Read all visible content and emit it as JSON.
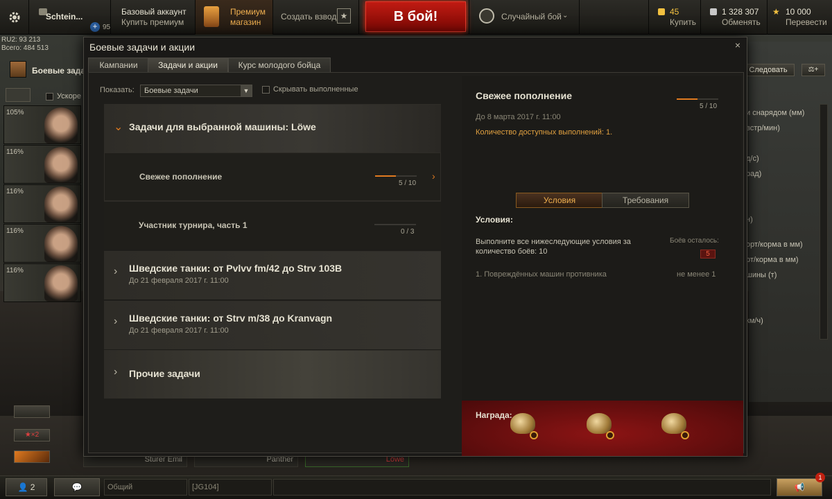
{
  "header": {
    "username": "Schtein...",
    "xp_boost_count": "95",
    "account_type": "Базовый аккаунт",
    "buy_premium": "Купить премиум",
    "premium_shop_line1": "Премиум",
    "premium_shop_line2": "магазин",
    "create_platoon": "Создать взвод",
    "battle_button": "В бой!",
    "battle_mode": "Случайный бой",
    "gold": "45",
    "gold_action": "Купить",
    "silver": "1 328 307",
    "silver_action": "Обменять",
    "free_xp": "10 000",
    "free_xp_action": "Перевести"
  },
  "server_info": {
    "line1": "RU2: 93 213",
    "line2": "Всего: 484 513"
  },
  "left_side": {
    "missions_label": "Боевые задач",
    "accelerate_label": "Ускоре"
  },
  "crew": [
    {
      "pct": "105%"
    },
    {
      "pct": "116%"
    },
    {
      "pct": "116%"
    },
    {
      "pct": "116%"
    },
    {
      "pct": "116%"
    }
  ],
  "right_side": {
    "research_button": "Следовать",
    "stats": [
      "и снарядом (мм)",
      "встр/мин)",
      "д/с)",
      "рад)",
      "н)",
      "орт/корма в мм)",
      "рт/корма в мм)",
      "шины (т)",
      "км/ч)"
    ]
  },
  "modal": {
    "title": "Боевые задачи и акции",
    "close": "×",
    "tabs": [
      "Кампании",
      "Задачи и акции",
      "Курс молодого бойца"
    ],
    "filter_label": "Показать:",
    "filter_value": "Боевые задачи",
    "hide_completed": "Скрывать выполненные",
    "groups": {
      "vehicle_group_title": "Задачи для выбранной машины: Löwe",
      "tasks": [
        {
          "name": "Свежее пополнение",
          "progress_text": "5 / 10",
          "progress": 0.5
        },
        {
          "name": "Участник турнира, часть 1",
          "progress_text": "0 / 3",
          "progress": 0.0
        }
      ],
      "swedish1_title": "Шведские танки: от Pvlvv fm/42 до Strv 103B",
      "swedish1_date": "До 21 февраля 2017 г. 11:00",
      "swedish2_title": "Шведские танки: от Strv m/38 до Kranvagn",
      "swedish2_date": "До 21 февраля 2017 г. 11:00",
      "other_title": "Прочие задачи"
    },
    "detail": {
      "title": "Свежее пополнение",
      "progress_text": "5 / 10",
      "progress": 0.5,
      "deadline": "До 8 марта 2017 г. 11:00",
      "available": "Количество доступных выполнений: 1.",
      "tab_conditions": "Условия",
      "tab_requirements": "Требования",
      "conditions_header": "Условия:",
      "condition_text": "Выполните все нижеследующие условия за количество боёв: 10",
      "battles_left_label": "Боёв осталось:",
      "battles_left": "5",
      "condition_item": "1. Повреждённых машин противника",
      "condition_req": "не менее 1",
      "reward_header": "Награда:"
    }
  },
  "carousel": {
    "tank1": "Sturer Emil",
    "tank2": "Panther",
    "tank3": "Löwe"
  },
  "bottom": {
    "platoon_count": "2",
    "channel": "Общий",
    "clan_tag": "[JG104]",
    "notifications": "1"
  },
  "colors": {
    "accent_orange": "#e07a20",
    "battle_red": "#c01b12",
    "gold": "#f2c040"
  }
}
